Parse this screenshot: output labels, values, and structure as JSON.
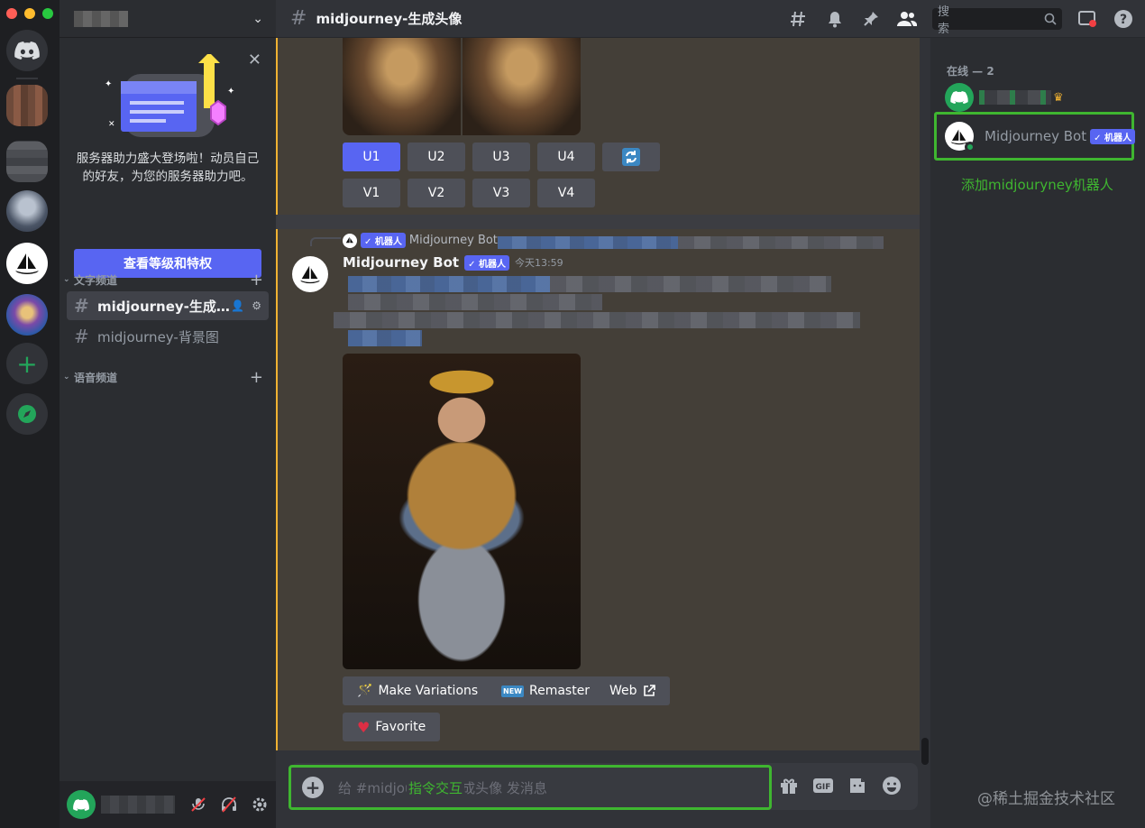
{
  "sidebar": {
    "boost_text": "服务器助力盛大登场啦！动员自己的好友，为您的服务器助力吧。",
    "boost_button": "查看等级和特权",
    "text_category": "文字频道",
    "voice_category": "语音频道",
    "channels": [
      {
        "label": "midjourney-生成..."
      },
      {
        "label": "midjourney-背景图"
      }
    ]
  },
  "header": {
    "channel_title": "midjourney-生成头像",
    "search_placeholder": "搜索"
  },
  "upscale_buttons": [
    "U1",
    "U2",
    "U3",
    "U4"
  ],
  "variation_buttons": [
    "V1",
    "V2",
    "V3",
    "V4"
  ],
  "message": {
    "reply_author": "Midjourney Bot",
    "bot_tag": "✓ 机器人",
    "author": "Midjourney Bot",
    "timestamp": "今天13:59",
    "actions": [
      "Make Variations",
      "Remaster",
      "Web",
      "Favorite"
    ]
  },
  "composer": {
    "placeholder": "给 #midjourney-生成头像 发消息",
    "annotation": "指令交互"
  },
  "members": {
    "online_header": "在线 — 2",
    "bot_name": "Midjourney Bot",
    "bot_tag": "✓ 机器人",
    "annotation": "添加midjouryney机器人"
  },
  "watermark": "@稀土掘金技术社区",
  "colors": {
    "blurple": "#5865f2",
    "annotation_green": "#3fb630",
    "highlight": "#443f38",
    "mention_bar": "#f0b232"
  }
}
